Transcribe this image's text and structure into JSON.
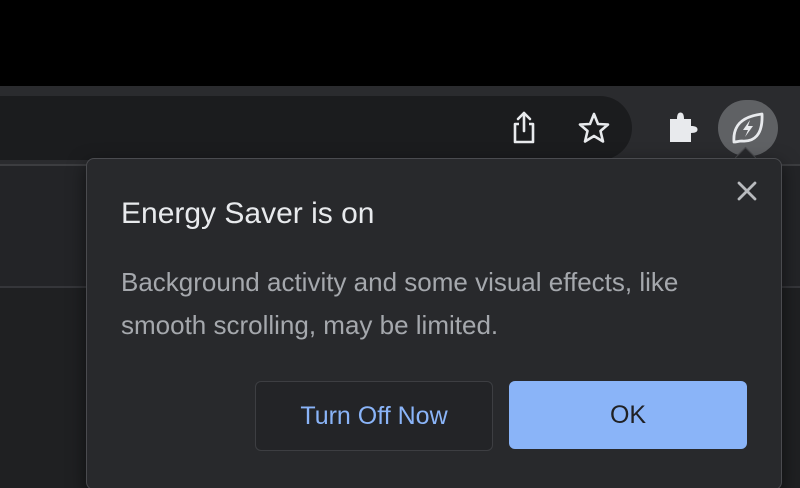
{
  "toolbar": {
    "share_icon": "share-icon",
    "bookmark_icon": "star-icon",
    "extensions_icon": "puzzle-piece-icon",
    "energy_saver_icon": "leaf-bolt-icon"
  },
  "bubble": {
    "title": "Energy Saver is on",
    "body": "Background activity and some visual effects, like smooth scrolling, may be limited.",
    "close_icon": "close-icon",
    "secondary_button_label": "Turn Off Now",
    "primary_button_label": "OK"
  },
  "colors": {
    "accent": "#8ab4f8",
    "bubble_background": "#28292c",
    "title_text": "#e8eaed",
    "body_text": "#a5a8ad"
  }
}
